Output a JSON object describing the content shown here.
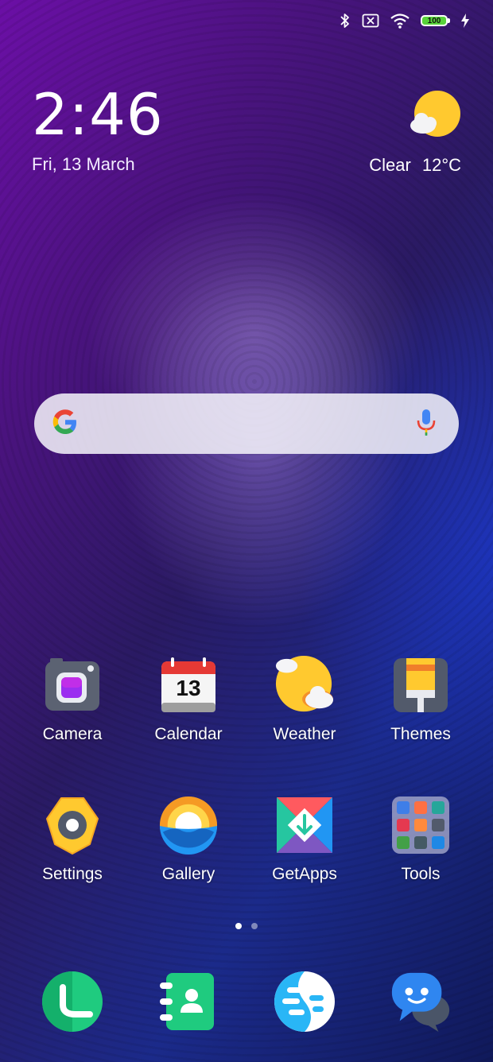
{
  "status_bar": {
    "icons": [
      "bluetooth-icon",
      "no-sim-icon",
      "wifi-icon",
      "battery-icon",
      "charging-icon"
    ],
    "battery_level": "100"
  },
  "clock": {
    "time": "2:46",
    "date": "Fri, 13 March"
  },
  "weather": {
    "condition": "Clear",
    "temperature": "12°C",
    "icon": "sun-cloud-icon"
  },
  "search": {
    "logo": "google-g-icon",
    "mic": "microphone-icon"
  },
  "apps": {
    "row1": [
      {
        "label": "Camera",
        "icon": "camera-icon"
      },
      {
        "label": "Calendar",
        "icon": "calendar-icon",
        "day": "13"
      },
      {
        "label": "Weather",
        "icon": "weather-icon"
      },
      {
        "label": "Themes",
        "icon": "themes-brush-icon"
      }
    ],
    "row2": [
      {
        "label": "Settings",
        "icon": "settings-gear-icon"
      },
      {
        "label": "Gallery",
        "icon": "gallery-icon"
      },
      {
        "label": "GetApps",
        "icon": "getapps-icon"
      },
      {
        "label": "Tools",
        "icon": "tools-folder-icon"
      }
    ]
  },
  "page_indicator": {
    "pages": 2,
    "active": 1
  },
  "dock": [
    {
      "name": "phone",
      "icon": "phone-icon"
    },
    {
      "name": "contacts",
      "icon": "contacts-icon"
    },
    {
      "name": "browser",
      "icon": "browser-icon"
    },
    {
      "name": "messages",
      "icon": "messages-icon"
    }
  ],
  "colors": {
    "battery_fill": "#58d23a",
    "weather_sun": "#ffc92f",
    "wallpaper_purple": "#6b0fa6",
    "wallpaper_blue": "#1b2a8a"
  }
}
